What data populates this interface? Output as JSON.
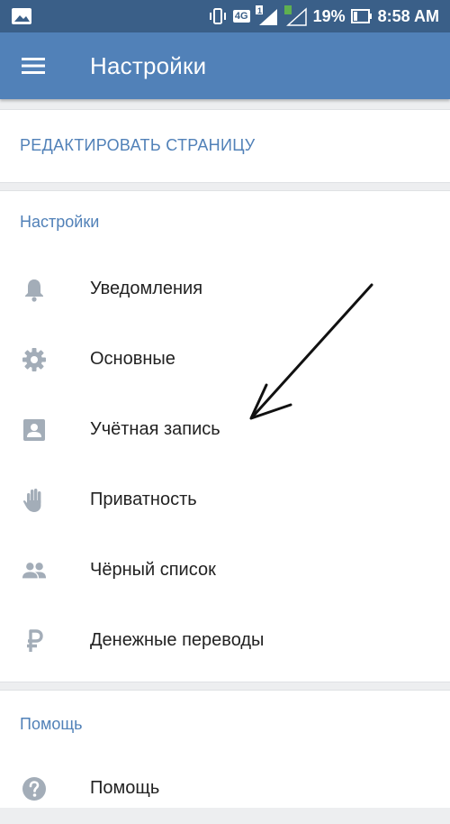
{
  "status_bar": {
    "battery": "19%",
    "time": "8:58 AM",
    "network": "4G",
    "sim": "1"
  },
  "app_bar": {
    "title": "Настройки"
  },
  "edit_page": {
    "label": "РЕДАКТИРОВАТЬ СТРАНИЦУ"
  },
  "settings_section": {
    "title": "Настройки",
    "items": [
      {
        "label": "Уведомления",
        "icon": "bell-icon"
      },
      {
        "label": "Основные",
        "icon": "gear-icon"
      },
      {
        "label": "Учётная запись",
        "icon": "account-icon"
      },
      {
        "label": "Приватность",
        "icon": "hand-icon"
      },
      {
        "label": "Чёрный список",
        "icon": "people-icon"
      },
      {
        "label": "Денежные переводы",
        "icon": "ruble-icon"
      }
    ]
  },
  "help_section": {
    "title": "Помощь",
    "items": [
      {
        "label": "Помощь",
        "icon": "help-icon"
      }
    ]
  },
  "colors": {
    "status_bar": "#3a5f88",
    "app_bar": "#5181b8",
    "accent": "#5181b8",
    "icon": "#a3adb8",
    "background": "#edeef0"
  }
}
